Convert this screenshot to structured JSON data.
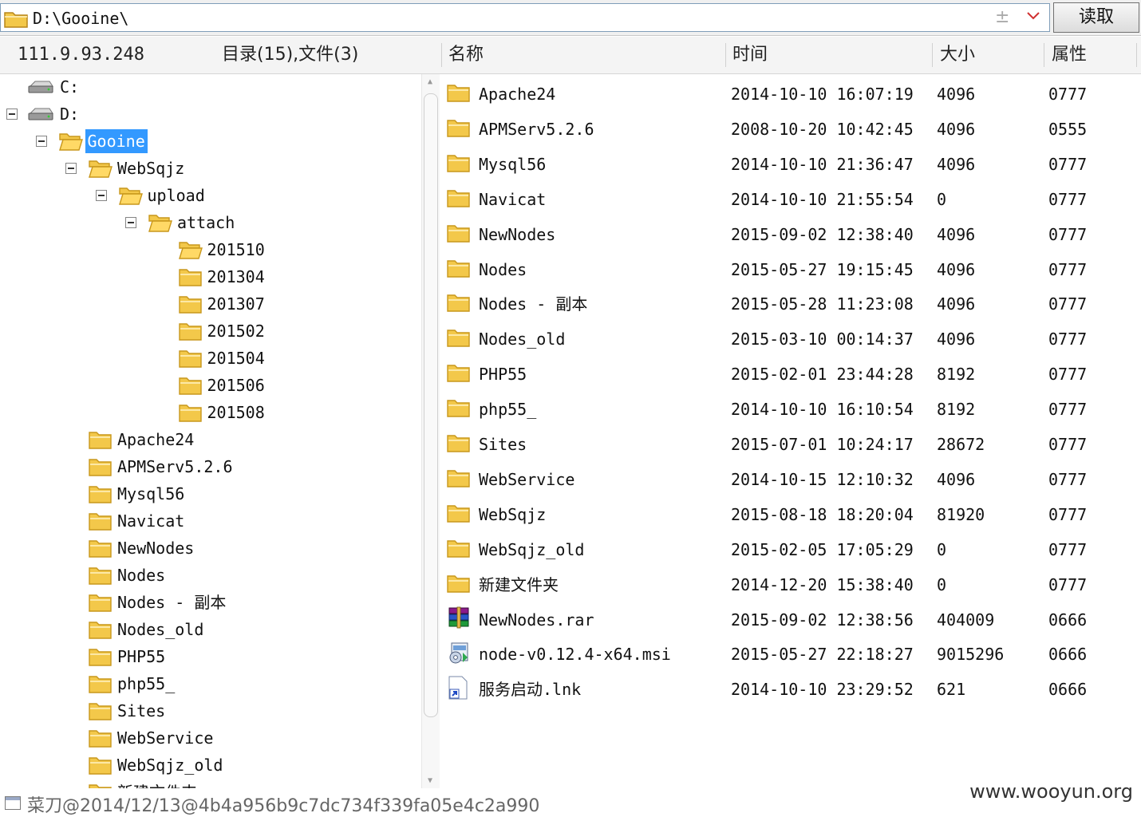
{
  "path": {
    "value": "D:\\Gooine\\",
    "read_label": "读取"
  },
  "header": {
    "ip": "111.9.93.248",
    "summary": "目录(15),文件(3)",
    "col_name": "名称",
    "col_time": "时间",
    "col_size": "大小",
    "col_attr": "属性"
  },
  "tree": [
    {
      "label": "C:",
      "kind": "drive",
      "level": 0,
      "toggle": false
    },
    {
      "label": "D:",
      "kind": "drive",
      "level": 0,
      "toggle": true
    },
    {
      "label": "Gooine",
      "kind": "folder",
      "level": 1,
      "toggle": true,
      "selected": true,
      "open": true
    },
    {
      "label": "WebSqjz",
      "kind": "folder",
      "level": 2,
      "toggle": true,
      "open": true
    },
    {
      "label": "upload",
      "kind": "folder",
      "level": 3,
      "toggle": true,
      "open": true
    },
    {
      "label": "attach",
      "kind": "folder",
      "level": 4,
      "toggle": true,
      "open": true
    },
    {
      "label": "201510",
      "kind": "folder",
      "level": 5,
      "toggle": false,
      "open": true
    },
    {
      "label": "201304",
      "kind": "folder",
      "level": 5,
      "toggle": false
    },
    {
      "label": "201307",
      "kind": "folder",
      "level": 5,
      "toggle": false
    },
    {
      "label": "201502",
      "kind": "folder",
      "level": 5,
      "toggle": false
    },
    {
      "label": "201504",
      "kind": "folder",
      "level": 5,
      "toggle": false
    },
    {
      "label": "201506",
      "kind": "folder",
      "level": 5,
      "toggle": false
    },
    {
      "label": "201508",
      "kind": "folder",
      "level": 5,
      "toggle": false
    },
    {
      "label": "Apache24",
      "kind": "folder",
      "level": 2,
      "toggle": false
    },
    {
      "label": "APMServ5.2.6",
      "kind": "folder",
      "level": 2,
      "toggle": false
    },
    {
      "label": "Mysql56",
      "kind": "folder",
      "level": 2,
      "toggle": false
    },
    {
      "label": "Navicat",
      "kind": "folder",
      "level": 2,
      "toggle": false
    },
    {
      "label": "NewNodes",
      "kind": "folder",
      "level": 2,
      "toggle": false
    },
    {
      "label": "Nodes",
      "kind": "folder",
      "level": 2,
      "toggle": false
    },
    {
      "label": "Nodes - 副本",
      "kind": "folder",
      "level": 2,
      "toggle": false
    },
    {
      "label": "Nodes_old",
      "kind": "folder",
      "level": 2,
      "toggle": false
    },
    {
      "label": "PHP55",
      "kind": "folder",
      "level": 2,
      "toggle": false
    },
    {
      "label": "php55_",
      "kind": "folder",
      "level": 2,
      "toggle": false
    },
    {
      "label": "Sites",
      "kind": "folder",
      "level": 2,
      "toggle": false
    },
    {
      "label": "WebService",
      "kind": "folder",
      "level": 2,
      "toggle": false
    },
    {
      "label": "WebSqjz_old",
      "kind": "folder",
      "level": 2,
      "toggle": false
    },
    {
      "label": "新建文件夹",
      "kind": "folder",
      "level": 2,
      "toggle": false
    }
  ],
  "files": [
    {
      "name": "Apache24",
      "time": "2014-10-10 16:07:19",
      "size": "4096",
      "attr": "0777",
      "icon": "folder-icon"
    },
    {
      "name": "APMServ5.2.6",
      "time": "2008-10-20 10:42:45",
      "size": "4096",
      "attr": "0555",
      "icon": "folder-icon"
    },
    {
      "name": "Mysql56",
      "time": "2014-10-10 21:36:47",
      "size": "4096",
      "attr": "0777",
      "icon": "folder-icon"
    },
    {
      "name": "Navicat",
      "time": "2014-10-10 21:55:54",
      "size": "0",
      "attr": "0777",
      "icon": "folder-icon"
    },
    {
      "name": "NewNodes",
      "time": "2015-09-02 12:38:40",
      "size": "4096",
      "attr": "0777",
      "icon": "folder-icon"
    },
    {
      "name": "Nodes",
      "time": "2015-05-27 19:15:45",
      "size": "4096",
      "attr": "0777",
      "icon": "folder-icon"
    },
    {
      "name": "Nodes - 副本",
      "time": "2015-05-28 11:23:08",
      "size": "4096",
      "attr": "0777",
      "icon": "folder-icon"
    },
    {
      "name": "Nodes_old",
      "time": "2015-03-10 00:14:37",
      "size": "4096",
      "attr": "0777",
      "icon": "folder-icon"
    },
    {
      "name": "PHP55",
      "time": "2015-02-01 23:44:28",
      "size": "8192",
      "attr": "0777",
      "icon": "folder-icon"
    },
    {
      "name": "php55_",
      "time": "2014-10-10 16:10:54",
      "size": "8192",
      "attr": "0777",
      "icon": "folder-icon"
    },
    {
      "name": "Sites",
      "time": "2015-07-01 10:24:17",
      "size": "28672",
      "attr": "0777",
      "icon": "folder-icon"
    },
    {
      "name": "WebService",
      "time": "2014-10-15 12:10:32",
      "size": "4096",
      "attr": "0777",
      "icon": "folder-icon"
    },
    {
      "name": "WebSqjz",
      "time": "2015-08-18 18:20:04",
      "size": "81920",
      "attr": "0777",
      "icon": "folder-icon"
    },
    {
      "name": "WebSqjz_old",
      "time": "2015-02-05 17:05:29",
      "size": "0",
      "attr": "0777",
      "icon": "folder-icon"
    },
    {
      "name": "新建文件夹",
      "time": "2014-12-20 15:38:40",
      "size": "0",
      "attr": "0777",
      "icon": "folder-icon"
    },
    {
      "name": "NewNodes.rar",
      "time": "2015-09-02 12:38:56",
      "size": "404009",
      "attr": "0666",
      "icon": "rar-archive-icon"
    },
    {
      "name": "node-v0.12.4-x64.msi",
      "time": "2015-05-27 22:18:27",
      "size": "9015296",
      "attr": "0666",
      "icon": "msi-installer-icon"
    },
    {
      "name": "服务启动.lnk",
      "time": "2014-10-10 23:29:52",
      "size": "621",
      "attr": "0666",
      "icon": "shortcut-icon"
    }
  ],
  "status": {
    "text": "菜刀@2014/12/13@4b4a956b9c7dc734f339fa05e4c2a990"
  },
  "watermark": "www.wooyun.org",
  "colors": {
    "selection": "#3399ff",
    "folder": "#f3c84a",
    "folder_edge": "#c8971c"
  }
}
